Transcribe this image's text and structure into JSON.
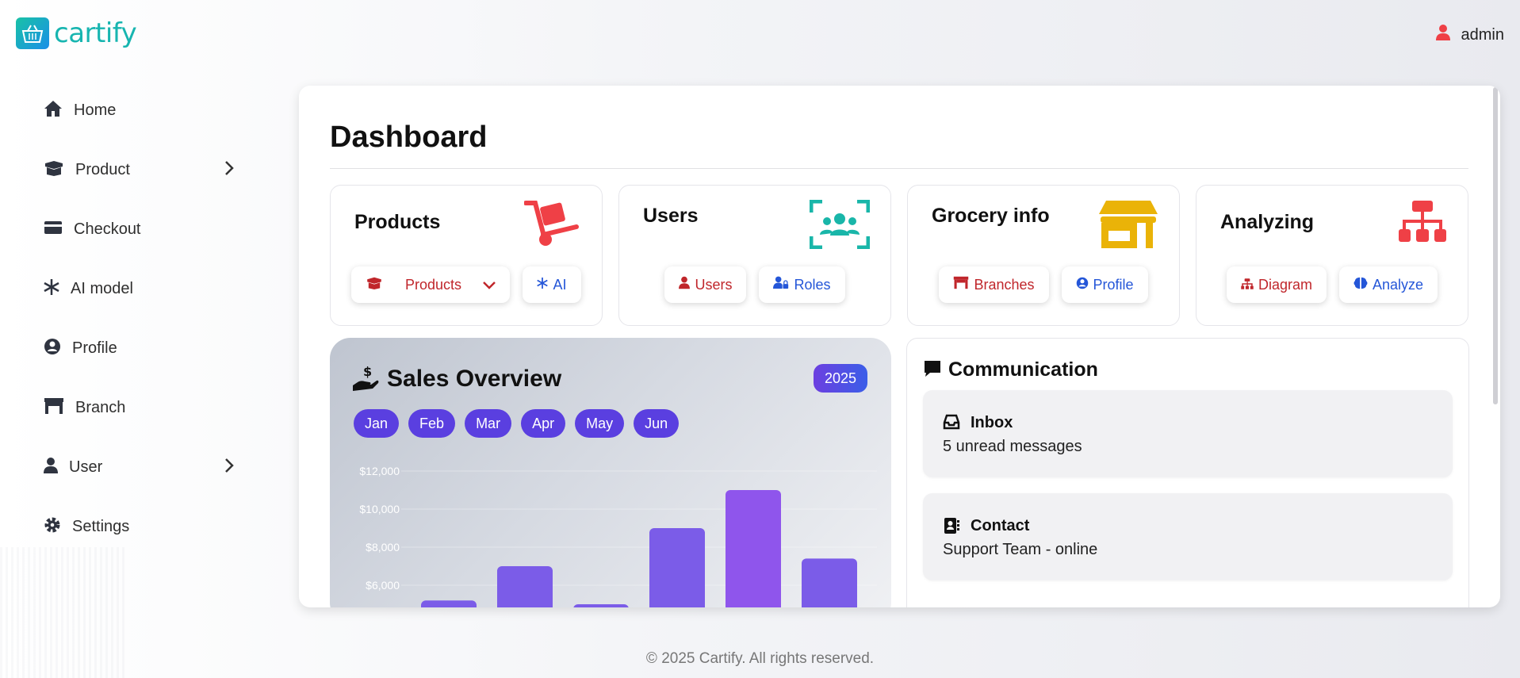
{
  "header": {
    "logo_text": "cartify",
    "user_name": "admin"
  },
  "sidebar": {
    "items": [
      {
        "label": "Home",
        "icon": "home-icon"
      },
      {
        "label": "Product",
        "icon": "box-icon",
        "expandable": true
      },
      {
        "label": "Checkout",
        "icon": "credit-card-icon"
      },
      {
        "label": "AI model",
        "icon": "snowflake-icon"
      },
      {
        "label": "Profile",
        "icon": "user-circle-icon"
      },
      {
        "label": "Branch",
        "icon": "store-icon"
      },
      {
        "label": "User",
        "icon": "user-icon",
        "expandable": true
      },
      {
        "label": "Settings",
        "icon": "gear-icon"
      }
    ]
  },
  "main": {
    "title": "Dashboard",
    "tiles": [
      {
        "title": "Products",
        "icon": "hand-truck-icon",
        "buttons": [
          "Products",
          "AI"
        ]
      },
      {
        "title": "Users",
        "icon": "users-scan-icon",
        "buttons": [
          "Users",
          "Roles"
        ]
      },
      {
        "title": "Grocery info",
        "icon": "shop-icon",
        "buttons": [
          "Branches",
          "Profile"
        ]
      },
      {
        "title": "Analyzing",
        "icon": "sitemap-icon",
        "buttons": [
          "Diagram",
          "Analyze"
        ]
      }
    ],
    "sales": {
      "title": "Sales Overview",
      "year": "2025",
      "months": [
        "Jan",
        "Feb",
        "Mar",
        "Apr",
        "May",
        "Jun"
      ]
    },
    "communication": {
      "title": "Communication",
      "cards": [
        {
          "title": "Inbox",
          "subtitle": "5 unread messages",
          "icon": "inbox-icon"
        },
        {
          "title": "Contact",
          "subtitle": "Support Team - online",
          "icon": "address-book-icon"
        }
      ]
    }
  },
  "chart_data": {
    "type": "bar",
    "categories": [
      "Jan",
      "Feb",
      "Mar",
      "Apr",
      "May",
      "Jun"
    ],
    "values": [
      5200,
      7000,
      5000,
      9000,
      11000,
      7400
    ],
    "yticks": [
      "$12,000",
      "$10,000",
      "$8,000",
      "$6,000"
    ],
    "ylim": [
      6000,
      12000
    ],
    "colors": {
      "bar": "#7b5ce8",
      "bar_highlight": "#8f55ec"
    }
  },
  "footer": {
    "text": "© 2025 Cartify. All rights reserved."
  },
  "colors": {
    "accent": "#5a3fe0",
    "danger": "#c0262b",
    "link_blue": "#2456d8",
    "brand_teal": "#17b5b0",
    "icon_red": "#ef4046",
    "icon_teal": "#19b6a9",
    "icon_yellow": "#eab308"
  }
}
